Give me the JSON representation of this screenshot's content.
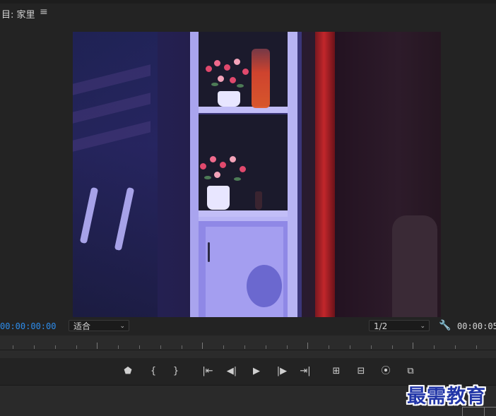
{
  "panel": {
    "title": "目: 家里",
    "menu_icon": "hamburger-menu-icon"
  },
  "viewer": {
    "timecode_current": "00:00:00:00",
    "timecode_duration": "00:00:05",
    "zoom_select": {
      "value": "适合"
    },
    "resolution_select": {
      "value": "1/2"
    },
    "settings_icon": "wrench-icon",
    "current_timecode_color": "#2d8ceb"
  },
  "transport": {
    "buttons": [
      {
        "name": "add-marker-button",
        "icon": "marker-icon",
        "glyph": "⬟"
      },
      {
        "name": "mark-in-button",
        "icon": "mark-in-icon",
        "glyph": "{"
      },
      {
        "name": "mark-out-button",
        "icon": "mark-out-icon",
        "glyph": "}"
      },
      {
        "name": "go-to-in-button",
        "icon": "go-to-in-icon",
        "glyph": "|⇤"
      },
      {
        "name": "step-back-button",
        "icon": "step-back-icon",
        "glyph": "◀|"
      },
      {
        "name": "play-button",
        "icon": "play-icon",
        "glyph": "▶"
      },
      {
        "name": "step-forward-button",
        "icon": "step-forward-icon",
        "glyph": "|▶"
      },
      {
        "name": "go-to-out-button",
        "icon": "go-to-out-icon",
        "glyph": "⇥|"
      },
      {
        "name": "lift-button",
        "icon": "lift-icon",
        "glyph": "⊞"
      },
      {
        "name": "extract-button",
        "icon": "extract-icon",
        "glyph": "⊟"
      },
      {
        "name": "export-frame-button",
        "icon": "camera-icon",
        "glyph": "⦿"
      },
      {
        "name": "comparison-view-button",
        "icon": "comparison-view-icon",
        "glyph": "⧉"
      }
    ]
  },
  "watermark": {
    "text": "最需教育",
    "color": "#2236a8"
  }
}
